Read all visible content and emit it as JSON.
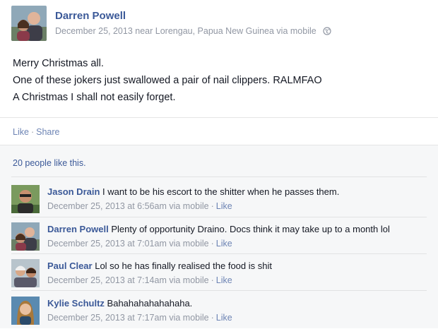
{
  "post": {
    "author": "Darren Powell",
    "date": "December 25, 2013",
    "location_text": "near Lorengau, Papua New Guinea via mobile",
    "audience_icon": "globe-icon",
    "lines": [
      "Merry Christmas all.",
      "One of these jokers just swallowed a pair of nail clippers. RALMFAO",
      "A Christmas I shall not easily forget."
    ]
  },
  "actions": {
    "like": "Like",
    "dot": "·",
    "share": "Share"
  },
  "likes_text": "20 people like this.",
  "comments": [
    {
      "author": "Jason Drain",
      "text": "I want to be his escort to the shitter when he passes them.",
      "time": "December 25, 2013 at 6:56am via mobile",
      "like": "Like"
    },
    {
      "author": "Darren Powell",
      "text": "Plenty of opportunity Draino. Docs think it may take up to a month lol",
      "time": "December 25, 2013 at 7:01am via mobile",
      "like": "Like"
    },
    {
      "author": "Paul Clear",
      "text": "Lol so he has finally realised the food is shit",
      "time": "December 25, 2013 at 7:14am via mobile",
      "like": "Like"
    },
    {
      "author": "Kylie Schultz",
      "text": "Bahahahahahahaha.",
      "time": "December 25, 2013 at 7:17am via mobile",
      "like": "Like"
    }
  ],
  "colors": {
    "link": "#3b5998",
    "meta": "#9197a3",
    "action": "#6d84b4",
    "feedback_bg": "#f6f7f8"
  }
}
